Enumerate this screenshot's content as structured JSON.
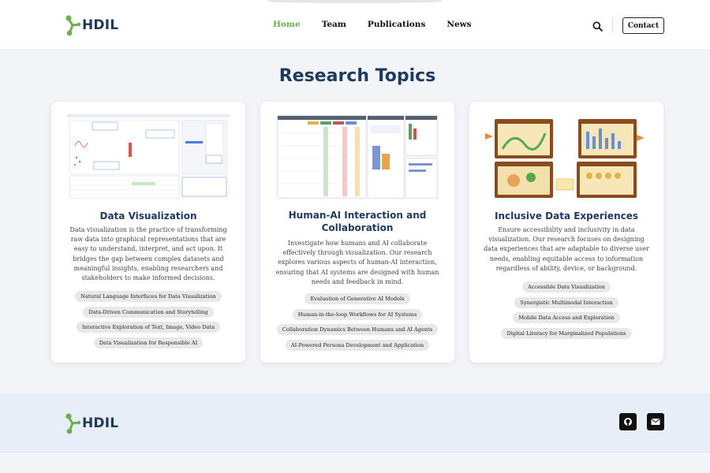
{
  "brand": {
    "name": "HDIL",
    "accent": "#6ab04c",
    "title_color": "#1e3a5f"
  },
  "nav": {
    "items": [
      {
        "label": "Home",
        "active": true
      },
      {
        "label": "Team",
        "active": false
      },
      {
        "label": "Publications",
        "active": false
      },
      {
        "label": "News",
        "active": false
      }
    ],
    "search_icon": "search-icon",
    "contact_label": "Contact"
  },
  "main": {
    "title": "Research Topics",
    "cards": [
      {
        "title": "Data Visualization",
        "description": "Data visualization is the practice of transforming raw data into graphical representations that are easy to understand, interpret, and act upon. It bridges the gap between complex datasets and meaningful insights, enabling researchers and stakeholders to make informed decisions.",
        "tags": [
          "Natural Language Interfaces for Data Visualization",
          "Data-Driven Communication and Storytelling",
          "Interactive Exploration of Text, Image, Video Data",
          "Data Visualization for Responsible AI"
        ]
      },
      {
        "title": "Human-AI Interaction and Collaboration",
        "description": "Investigate how humans and AI collaborate effectively through visualization. Our research explores various aspects of human-AI interaction, ensuring that AI systems are designed with human needs and feedback in mind.",
        "tags": [
          "Evaluation of Generative AI Models",
          "Human-in-the-loop Workflows for AI Systems",
          "Collaboration Dynamics Between Humans and AI Agents",
          "AI-Powered Persona Development and Application"
        ]
      },
      {
        "title": "Inclusive Data Experiences",
        "description": "Ensure accessibility and inclusivity in data visualization. Our research focuses on designing data experiences that are adaptable to diverse user needs, enabling equitable access to information regardless of ability, device, or background.",
        "tags": [
          "Accessible Data Visualization",
          "Synergistic Multimodal Interaction",
          "Mobile Data Access and Exploration",
          "Digital Literacy for Marginalized Populations"
        ]
      }
    ]
  },
  "footer": {
    "brand": "HDIL",
    "social": [
      "github-icon",
      "mail-icon"
    ]
  }
}
